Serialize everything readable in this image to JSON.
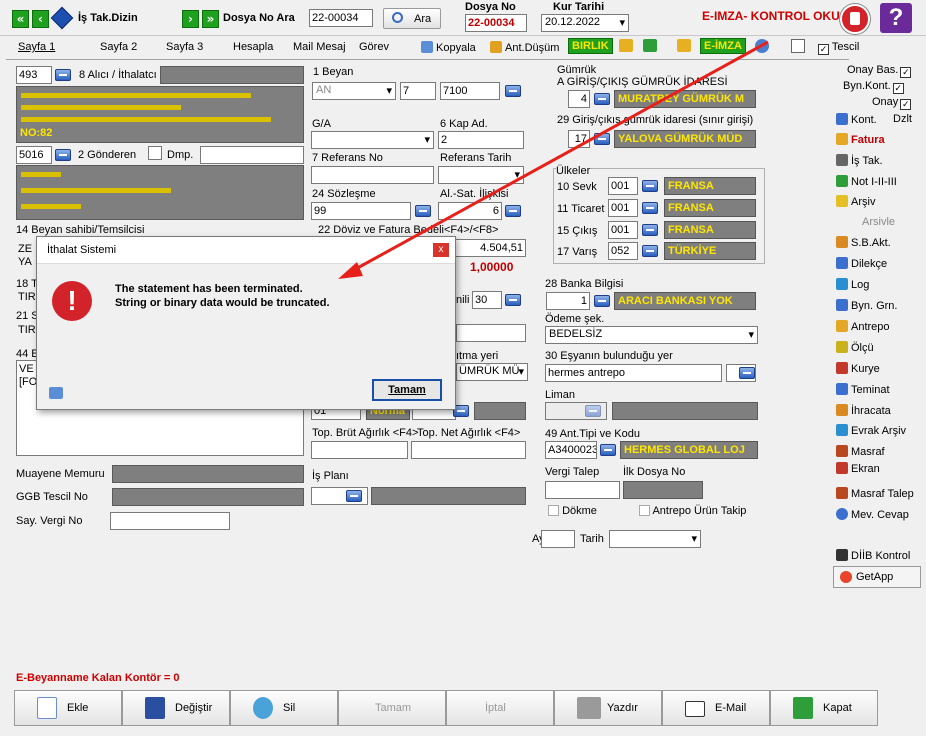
{
  "topbar": {
    "nav_prev_first": "«",
    "nav_prev": "‹",
    "is_takip_dizin_label": "İş Tak.Dizin",
    "dosya_no_ara_label": "Dosya No Ara",
    "search_value": "22-00034",
    "ara_button": "Ara",
    "dosya_no_caption": "Dosya No",
    "dosya_no_value": "22-00034",
    "kur_tarihi_caption": "Kur Tarihi",
    "kur_tarihi_value": "20.12.2022",
    "eimza_status": "E-IMZA- KONTROL OKU",
    "help_label": "?"
  },
  "tabs": [
    "Sayfa 1",
    "Sayfa 2",
    "Sayfa 3",
    "Hesapla",
    "Mail Mesaj",
    "Görev",
    "Kopyala",
    "Ant.Düşüm",
    "BIRLIK",
    "E-İMZA",
    "Tescil"
  ],
  "form": {
    "alici_code": "493",
    "alici_label": "8 Alıcı / İthalatcı",
    "alici_addr_tail": "NO:82",
    "gonderen_code": "5016",
    "gonderen_label": "2 Gönderen",
    "dmp_label": "Dmp.",
    "beyan_label": "1 Beyan",
    "beyan_an": "AN",
    "beyan_7": "7",
    "beyan_7100": "7100",
    "ga_label": "G/A",
    "kap_adet_label": "6 Kap Ad.",
    "kap_adet_value": "2",
    "ref_no_label": "7 Referans No",
    "ref_tarih_label": "Referans Tarih",
    "sozlesme_label": "24 Sözleşme",
    "sozlesme_value": "99",
    "alsat_label": "Al.-Sat. İlişkisi",
    "alsat_value": "6",
    "beyan_sahibi_label": "14 Beyan sahibi/Temsilcisi",
    "doviz_label": "22 Döviz ve Fatura Bedeli<F4>/<F8>",
    "fatura_tutar": "4.504,51",
    "kur_value": "1,00000",
    "field18_label": "18 T",
    "field21_label": "21 S",
    "field44_label": "44 E",
    "row_tir1": "TIR",
    "row_tir2": "TIR",
    "row_ze": "ZE",
    "row_ya": "YA",
    "row_ve": "VE",
    "row_fo": "[FO",
    "nili_label": "nili",
    "nili_value": "30",
    "cikis_yeri_label": "ıtma yeri",
    "cikis_yeri_value": "ÜMRÜK MÜ",
    "yuk_code": "01",
    "yuk_name": "Norma",
    "brut_label": "Top. Brüt Ağırlık <F4>",
    "net_label": "Top. Net Ağırlık <F4>",
    "muayene_label": "Muayene Memuru",
    "ggb_label": "GGB Tescil No",
    "sayvergi_label": "Say. Vergi No",
    "is_plani_label": "İş Planı",
    "gumruk_caption": "Gümrük",
    "gumruk_label": "A GİRİŞ/ÇIKIŞ GÜMRÜK İDARESİ",
    "gumruk_code": "4",
    "gumruk_name": "MURATBEY GÜMRÜK M",
    "giris_label": "29 Giriş/çıkış gümrük idaresi (sınır girişi)",
    "giris_code": "17",
    "giris_name": "YALOVA GÜMRÜK MÜD",
    "ulkeler_label": "Ülkeler",
    "sevk_label": "10 Sevk",
    "sevk_code": "001",
    "sevk_name": "FRANSA",
    "ticaret_label": "11 Ticaret",
    "ticaret_code": "001",
    "ticaret_name": "FRANSA",
    "cikis_label": "15 Çıkış",
    "cikis_code": "001",
    "cikis_name": "FRANSA",
    "varis_label": "17 Varış",
    "varis_code": "052",
    "varis_name": "TÜRKİYE",
    "banka_label": "28 Banka Bilgisi",
    "banka_code": "1",
    "banka_name": "ARACI BANKASI YOK",
    "odeme_label": "Ödeme şek.",
    "odeme_value": "BEDELSİZ",
    "esya_yer_label": "30 Eşyanın bulunduğu yer",
    "esya_yer_value": "hermes antrepo",
    "liman_label": "Liman",
    "ant_tipi_label": "49 Ant.Tipi ve Kodu",
    "ant_code": "A3400023",
    "ant_name": "HERMES GLOBAL LOJ",
    "vergi_talep_label": "Vergi Talep",
    "ilk_dosya_label": "İlk Dosya No",
    "dokme_label": "Dökme",
    "antrepo_urun_label": "Antrepo Ürün Takip",
    "ay_label": "Ay",
    "tarih_label": "Tarih",
    "kontor_status": "E-Beyanname Kalan Kontör = 0"
  },
  "sidebar": {
    "onay_bas": "Onay Bas.",
    "byn_kont": "Byn.Kont.",
    "onay": "Onay",
    "items": [
      "Kont.",
      "Dzlt",
      "Fatura",
      "İş Tak.",
      "Not I-II-III",
      "Arşiv",
      "Arsivle",
      "S.B.Akt.",
      "Dilekçe",
      "Log",
      "Byn. Grn.",
      "Antrepo",
      "Ölçü",
      "Kurye",
      "Teminat",
      "İhracata",
      "Evrak Arşiv",
      "Masraf",
      "Ekran",
      "Masraf Talep",
      "Mev. Cevap",
      "DİİB Kontrol",
      "GetApp"
    ]
  },
  "bottom_buttons": [
    "Ekle",
    "Değiştir",
    "Sil",
    "Tamam",
    "İptal",
    "Yazdır",
    "E-Mail",
    "Kapat"
  ],
  "dialog": {
    "title": "İthalat Sistemi",
    "close": "x",
    "line1": "The statement has been terminated.",
    "line2": "String or binary data would be truncated.",
    "ok_button": "Tamam",
    "error_icon": "!"
  },
  "colors": {
    "accent_green": "#1fa11f",
    "field_grey": "#7f7f7f",
    "field_yellow_text": "#ffe600",
    "error_red": "#d2232a",
    "arrow_red": "#e8201a",
    "status_red": "#d00000"
  }
}
